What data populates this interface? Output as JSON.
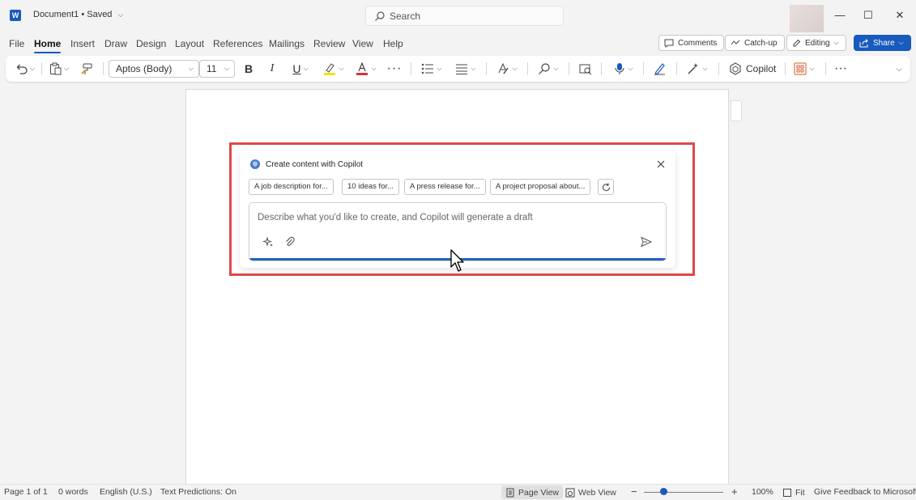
{
  "app": {
    "document_title": "Document1",
    "save_status": "• Saved",
    "search_label": "Search"
  },
  "tabs": [
    "File",
    "Home",
    "Insert",
    "Draw",
    "Design",
    "Layout",
    "References",
    "Mailings",
    "Review",
    "View",
    "Help"
  ],
  "active_tab": "Home",
  "header_actions": {
    "comments": "Comments",
    "catchup": "Catch-up",
    "editing": "Editing",
    "share": "Share"
  },
  "ribbon": {
    "font_name": "Aptos (Body)",
    "font_size": "11",
    "copilot": "Copilot",
    "highlight_color": "#f5e400",
    "font_color": "#d13438"
  },
  "copilot_dialog": {
    "title": "Create content with Copilot",
    "suggestions": [
      "A job description for...",
      "10 ideas for...",
      "A press release for...",
      "A project proposal about..."
    ],
    "placeholder": "Describe what you'd like to create, and Copilot will generate a draft"
  },
  "status_bar": {
    "page": "Page 1 of 1",
    "words": "0 words",
    "language": "English (U.S.)",
    "text_predictions": "Text Predictions: On",
    "page_view": "Page View",
    "web_view": "Web View",
    "zoom": "100%",
    "zoom_fraction": 0.25,
    "fit": "Fit",
    "feedback": "Give Feedback to Microsoft"
  },
  "colors": {
    "accent": "#185abd",
    "highlight_frame": "#e04848"
  }
}
